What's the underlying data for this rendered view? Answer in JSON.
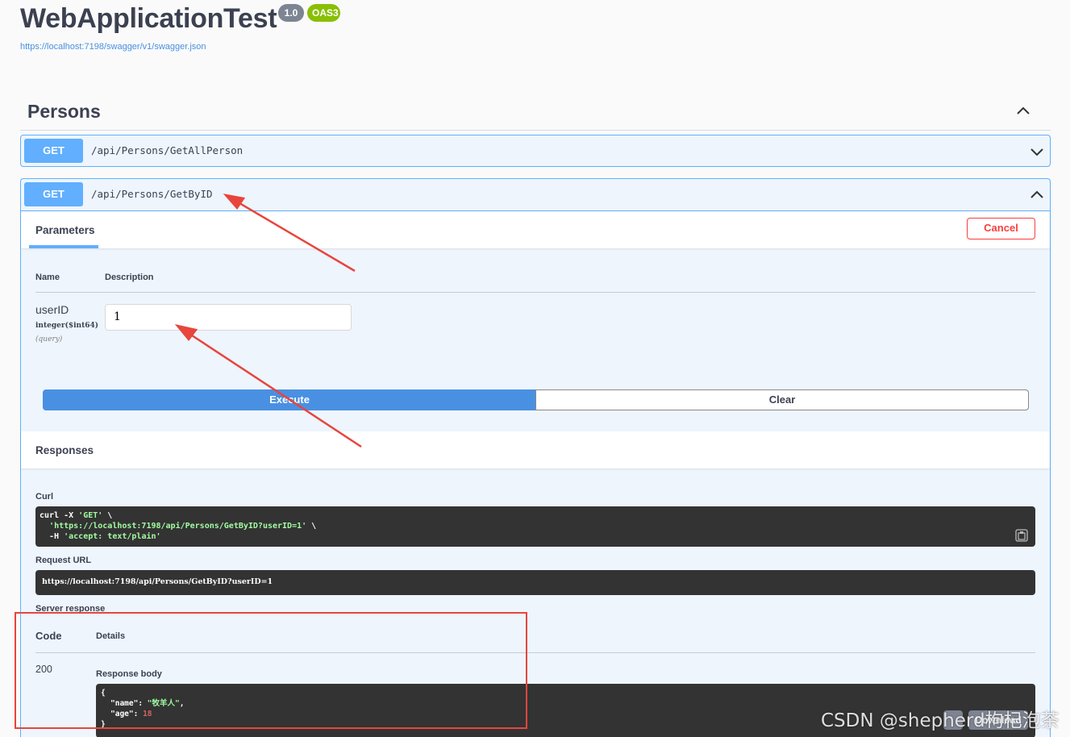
{
  "header": {
    "title": "WebApplicationTest",
    "version_badge": "1.0",
    "oas_badge": "OAS3",
    "spec_url": "https://localhost:7198/swagger/v1/swagger.json"
  },
  "tag": {
    "name": "Persons"
  },
  "operations": [
    {
      "method": "GET",
      "path": "/api/Persons/GetAllPerson"
    },
    {
      "method": "GET",
      "path": "/api/Persons/GetByID"
    }
  ],
  "parameters": {
    "tab_label": "Parameters",
    "cancel_label": "Cancel",
    "col_name": "Name",
    "col_description": "Description",
    "items": [
      {
        "name": "userID",
        "type": "integer($int64)",
        "in": "(query)",
        "value": "1"
      }
    ],
    "execute_label": "Execute",
    "clear_label": "Clear"
  },
  "responses": {
    "title": "Responses",
    "curl_label": "Curl",
    "curl_lines": [
      {
        "pre": "curl -X ",
        "str": "'GET'",
        "post": " \\"
      },
      {
        "pre": "  ",
        "str": "'https://localhost:7198/api/Persons/GetByID?userID=1'",
        "post": " \\"
      },
      {
        "pre": "  -H ",
        "str": "'accept: text/plain'",
        "post": ""
      }
    ],
    "request_url_label": "Request URL",
    "request_url": "https://localhost:7198/api/Persons/GetByID?userID=1",
    "server_response_label": "Server response",
    "code_head": "Code",
    "details_head": "Details",
    "code": "200",
    "body_label": "Response body",
    "body": {
      "open": "{",
      "name_key": "\"name\"",
      "name_val": "\"牧羊人\"",
      "age_key": "\"age\"",
      "age_val": "18",
      "close": "}"
    },
    "download_label": "Download"
  },
  "watermark": "CSDN @shepherd枸杞泡茶",
  "colors": {
    "get": "#61affe",
    "execute": "#4990e2",
    "cancel": "#f93e3e",
    "annotation": "#e8453c"
  },
  "icons": [
    "chevron-up-icon",
    "chevron-down-icon",
    "copy-icon"
  ]
}
